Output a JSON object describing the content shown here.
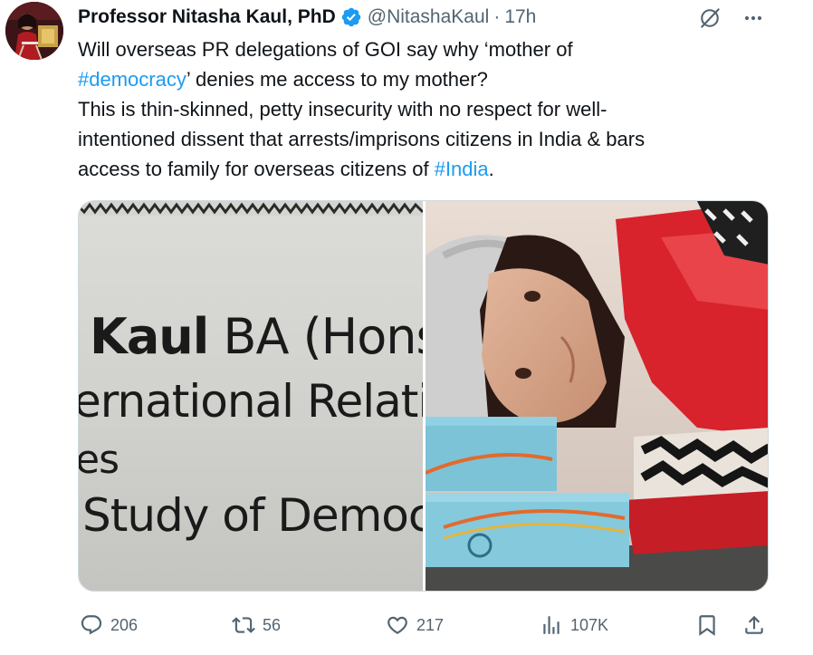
{
  "author": {
    "name": "Professor Nitasha Kaul, PhD",
    "handle": "@NitashaKaul",
    "separator": "·",
    "time": "17h",
    "verified": true
  },
  "tweet": {
    "lines": [
      [
        {
          "text": "Will overseas PR delegations of GOI say why ‘mother of",
          "tag": false
        }
      ],
      [
        {
          "text": "#democracy",
          "tag": true
        },
        {
          "text": "’ denies me access to my mother?",
          "tag": false
        }
      ],
      [
        {
          "text": "This is thin-skinned, petty insecurity with no respect for well-",
          "tag": false
        }
      ],
      [
        {
          "text": "intentioned dissent that arrests/imprisons citizens in India & bars",
          "tag": false
        }
      ],
      [
        {
          "text": "access to family for overseas citizens of ",
          "tag": false
        },
        {
          "text": "#India",
          "tag": true
        },
        {
          "text": ".",
          "tag": false
        }
      ]
    ]
  },
  "media": {
    "left_photo_text": {
      "line1_bold": "Kaul",
      "line1_rest": " BA (Hons),",
      "line2": "ernational Relatic",
      "line3": "es",
      "line4": "Study of Democr"
    }
  },
  "actions": {
    "replies": "206",
    "reposts": "56",
    "likes": "217",
    "views": "107K"
  },
  "icons": {
    "reply": "reply-icon",
    "repost": "repost-icon",
    "like": "heart-icon",
    "views": "views-icon",
    "bookmark": "bookmark-icon",
    "share": "share-icon",
    "grok": "grok-icon",
    "more": "more-icon",
    "verified": "verified-badge-icon"
  },
  "colors": {
    "text": "#0f1419",
    "secondary": "#536471",
    "accent": "#1d9bf0",
    "border": "#cfd9de"
  }
}
